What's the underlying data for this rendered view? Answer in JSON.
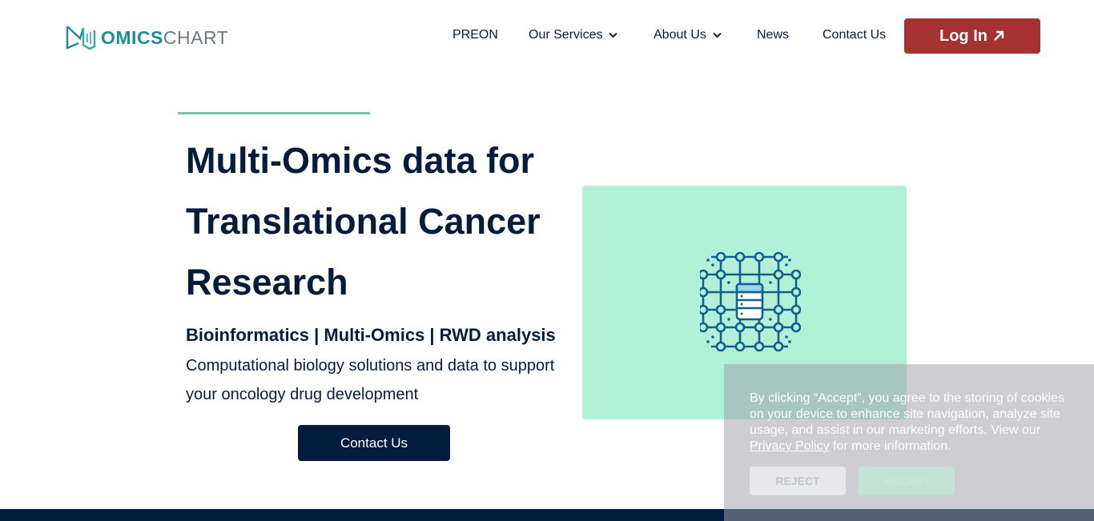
{
  "header": {
    "logo": {
      "part1": "OMICS",
      "part2": "CHART"
    },
    "nav": [
      {
        "label": "PREON"
      },
      {
        "label": "Our Services"
      },
      {
        "label": "About Us"
      },
      {
        "label": "News"
      },
      {
        "label": "Contact Us"
      }
    ],
    "login_label": "Log In"
  },
  "hero": {
    "title_lines": [
      "Multi-Omics data for",
      "Translational Cancer",
      "Research"
    ],
    "subtitle": "Bioinformatics | Multi-Omics | RWD analysis",
    "description": "Computational biology solutions and data to support your oncology drug development",
    "button_label": "Contact Us"
  },
  "cookie": {
    "text_before": "By clicking “Accept”, you agree to the storing of cookies on your device to enhance site navigation, analyze site usage, and assist in our marketing efforts. View our ",
    "link_label": "Privacy Policy",
    "text_after": " for more information.",
    "reject_label": "REJECT",
    "accept_label": "ACCEPT"
  },
  "colors": {
    "brand_navy": "#061c3d",
    "brand_red": "#a53131",
    "brand_teal": "#1a8f9a",
    "panel_mint": "#b0f1d7",
    "accent_green": "#7fc4a6",
    "icon_blue": "#125f8e"
  },
  "icons": {
    "logo": "dna-book-logo-icon",
    "dropdown": "chevron-down-icon",
    "external": "arrow-up-right-icon",
    "panel": "data-network-database-icon"
  }
}
